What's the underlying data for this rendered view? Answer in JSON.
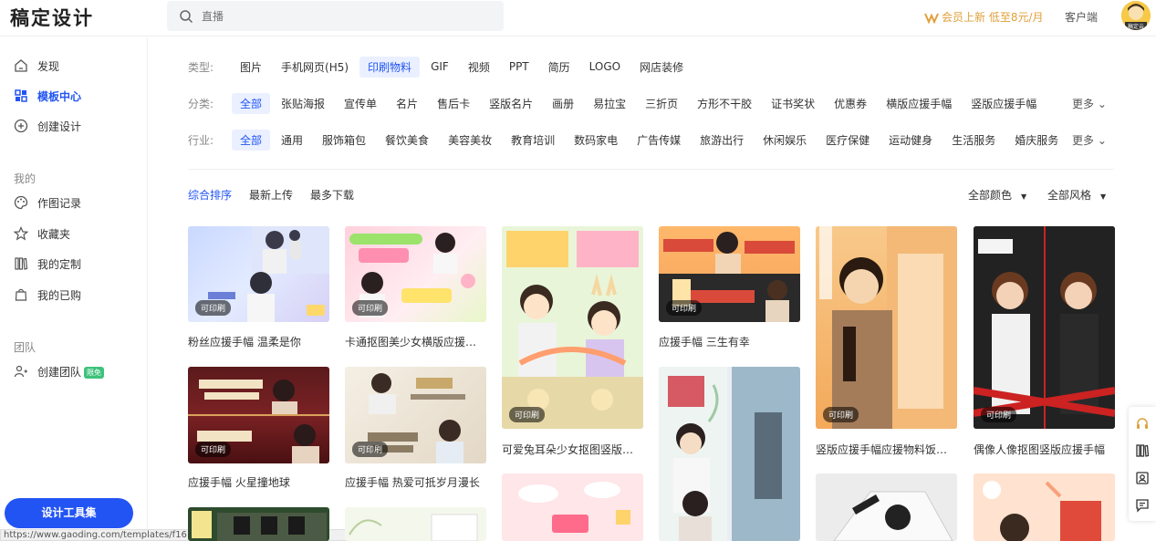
{
  "header": {
    "logo": "稿定设计",
    "search_placeholder": "直播",
    "vip_text": "会员上新 低至8元/月",
    "client_label": "客户端",
    "avatar_text": "稿定云"
  },
  "sidebar": {
    "items": [
      {
        "label": "发现",
        "icon": "home-icon"
      },
      {
        "label": "模板中心",
        "icon": "grid-icon"
      },
      {
        "label": "创建设计",
        "icon": "plus-circle-icon"
      }
    ],
    "my_title": "我的",
    "my_items": [
      {
        "label": "作图记录",
        "icon": "palette-icon"
      },
      {
        "label": "收藏夹",
        "icon": "star-icon"
      },
      {
        "label": "我的定制",
        "icon": "book-icon"
      },
      {
        "label": "我的已购",
        "icon": "bag-icon"
      }
    ],
    "team_title": "团队",
    "team_item": {
      "label": "创建团队",
      "badge": "限免"
    },
    "tool_button": "设计工具集"
  },
  "status_url": "https://www.gaoding.com/templates/f1612600",
  "filters": {
    "type_label": "类型:",
    "types": [
      "图片",
      "手机网页(H5)",
      "印刷物料",
      "GIF",
      "视频",
      "PPT",
      "简历",
      "LOGO",
      "网店装修"
    ],
    "category_label": "分类:",
    "categories": [
      "全部",
      "张贴海报",
      "宣传单",
      "名片",
      "售后卡",
      "竖版名片",
      "画册",
      "易拉宝",
      "三折页",
      "方形不干胶",
      "证书奖状",
      "优惠券",
      "横版应援手幅",
      "竖版应援手幅"
    ],
    "industry_label": "行业:",
    "industries": [
      "全部",
      "通用",
      "服饰箱包",
      "餐饮美食",
      "美容美妆",
      "教育培训",
      "数码家电",
      "广告传媒",
      "旅游出行",
      "休闲娱乐",
      "医疗保健",
      "运动健身",
      "生活服务",
      "婚庆服务"
    ],
    "more": "更多"
  },
  "sort": {
    "options": [
      "综合排序",
      "最新上传",
      "最多下载"
    ],
    "color_filter": "全部颜色",
    "style_filter": "全部风格"
  },
  "cards": {
    "tag": "可印刷",
    "titles": [
      "粉丝应援手幅 温柔是你",
      "卡通抠图美少女横版应援手幅",
      "可爱兔耳朵少女抠图竖版应...",
      "应援手幅 三生有幸",
      "竖版应援手幅应援物料饭圈...",
      "偶像人像抠图竖版应援手幅",
      "应援手幅 火星撞地球",
      "应援手幅 热爱可抵岁月漫长"
    ]
  },
  "colors": {
    "accent": "#2254f4",
    "vip": "#e0a03b"
  }
}
